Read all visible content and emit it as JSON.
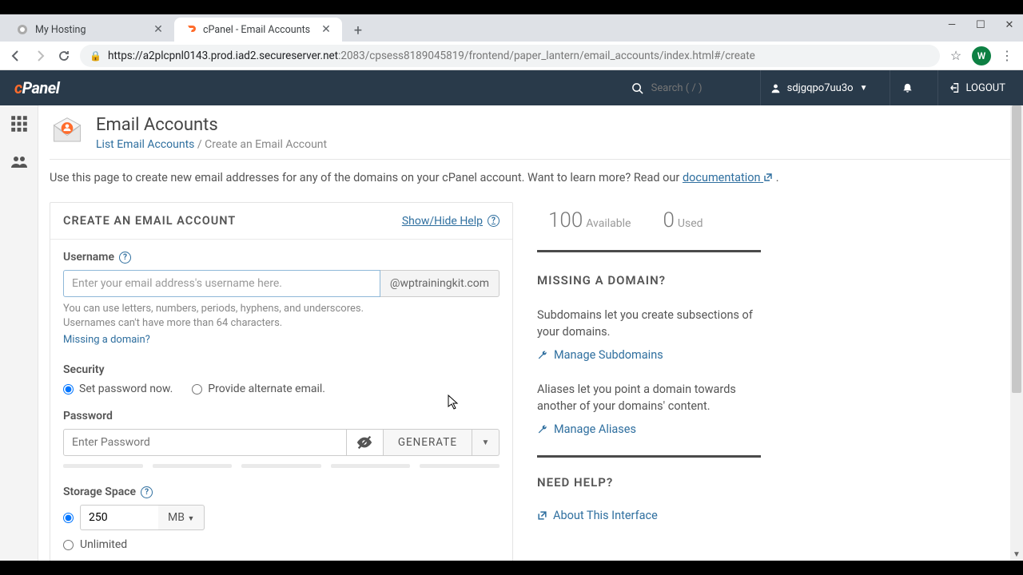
{
  "browser": {
    "tabs": [
      {
        "title": "My Hosting",
        "active": false
      },
      {
        "title": "cPanel - Email Accounts",
        "active": true
      }
    ],
    "url_host": "https://a2plcpnl0143.prod.iad2.secureserver.net",
    "url_port": ":2083",
    "url_path": "/cpsess8189045819/frontend/paper_lantern/email_accounts/index.html#/create",
    "avatar_letter": "W"
  },
  "header": {
    "logo_prefix": "c",
    "logo_rest": "Panel",
    "search_placeholder": "Search ( / )",
    "username": "sdjgqpo7uu3o",
    "logout": "LOGOUT"
  },
  "page": {
    "title": "Email Accounts",
    "breadcrumb_link": "List Email Accounts",
    "breadcrumb_sep": " / ",
    "breadcrumb_current": "Create an Email Account",
    "intro_prefix": "Use this page to create new email addresses for any of the domains on your cPanel account. Want to learn more? Read our ",
    "intro_link": "documentation",
    "intro_suffix": " ."
  },
  "form": {
    "heading": "CREATE AN EMAIL ACCOUNT",
    "help_toggle": "Show/Hide Help",
    "username_label": "Username",
    "username_placeholder": "Enter your email address's username here.",
    "domain_addon": "@wptrainingkit.com",
    "username_hint1": "You can use letters, numbers, periods, hyphens, and underscores.",
    "username_hint2": "Usernames can't have more than 64 characters.",
    "missing_domain_link": "Missing a domain?",
    "security_label": "Security",
    "security_opt1": "Set password now.",
    "security_opt2": "Provide alternate email.",
    "password_label": "Password",
    "password_placeholder": "Enter Password",
    "generate_label": "GENERATE",
    "storage_label": "Storage Space",
    "storage_value": "250",
    "storage_unit": "MB",
    "unlimited_label": "Unlimited"
  },
  "sidebar": {
    "available_num": "100",
    "available_lbl": "Available",
    "used_num": "0",
    "used_lbl": "Used",
    "missing_heading": "MISSING A DOMAIN?",
    "sub_text": "Subdomains let you create subsections of your domains.",
    "sub_link": "Manage Subdomains",
    "alias_text": "Aliases let you point a domain towards another of your domains' content.",
    "alias_link": "Manage Aliases",
    "help_heading": "NEED HELP?",
    "about_link": "About This Interface"
  }
}
